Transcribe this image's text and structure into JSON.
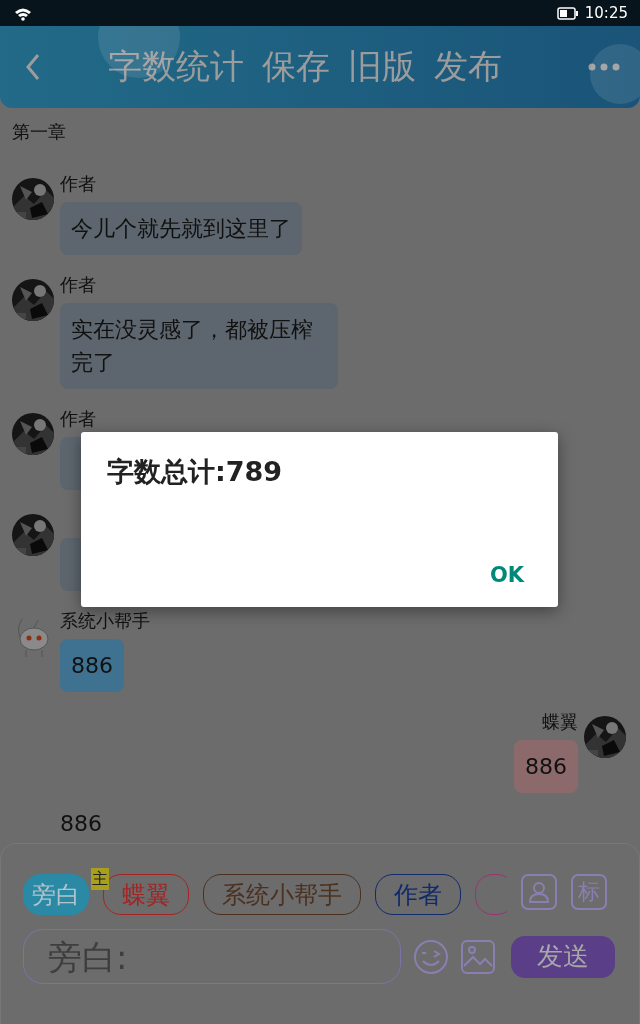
{
  "status_bar": {
    "time": "10:25"
  },
  "header": {
    "actions": [
      "字数统计",
      "保存",
      "旧版",
      "发布"
    ]
  },
  "chapter_title": "第一章",
  "messages": [
    {
      "kind": "author",
      "sender": "作者",
      "text": "今儿个就先就到这里了"
    },
    {
      "kind": "author",
      "sender": "作者",
      "text": "实在没灵感了，都被压榨完了"
    },
    {
      "kind": "author",
      "sender": "作者"
    },
    {
      "kind": "author"
    },
    {
      "kind": "helper",
      "sender": "系统小帮手",
      "text": "886"
    },
    {
      "kind": "self",
      "sender": "蝶翼",
      "text": "886"
    },
    {
      "kind": "narration",
      "text": "886"
    }
  ],
  "roles": [
    {
      "label": "旁白",
      "color": "#2a8aa6",
      "selected": true
    },
    {
      "label": "蝶翼",
      "color": "#a42424",
      "selected": false,
      "badge": "主"
    },
    {
      "label": "系统小帮手",
      "color": "#4c3020",
      "selected": false
    },
    {
      "label": "作者",
      "color": "#102a6a",
      "selected": false
    },
    {
      "color": "#9c3272",
      "selected": false
    }
  ],
  "role_buttons": [
    "标"
  ],
  "input": {
    "placeholder": "旁白:"
  },
  "send_button": "发送",
  "dialog": {
    "message": "字数总计:789",
    "button": "OK"
  }
}
